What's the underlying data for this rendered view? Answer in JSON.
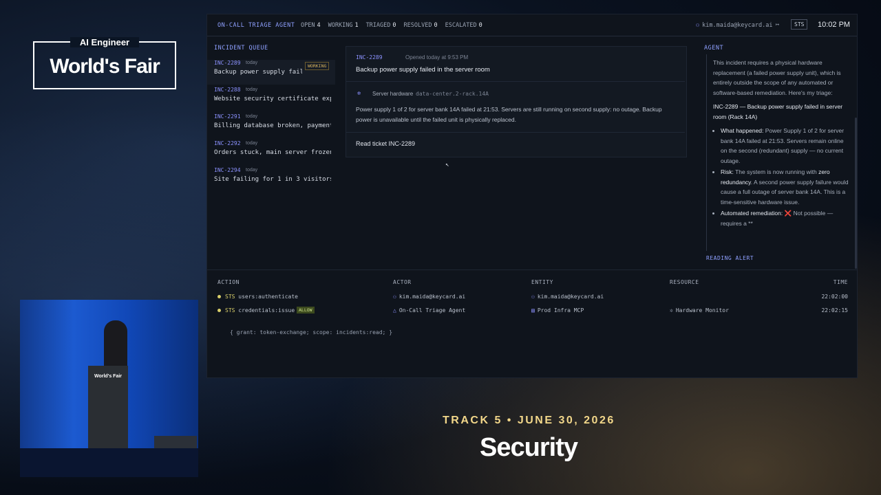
{
  "event": {
    "logo_top": "AI Engineer",
    "logo_main": "World's Fair",
    "podium_label": "World's Fair"
  },
  "stage": {
    "track": "TRACK 5 • JUNE 30, 2026",
    "topic": "Security"
  },
  "topbar": {
    "title": "ON-CALL TRIAGE AGENT",
    "counts": [
      {
        "label": "OPEN",
        "value": "4"
      },
      {
        "label": "WORKING",
        "value": "1"
      },
      {
        "label": "TRIAGED",
        "value": "0"
      },
      {
        "label": "RESOLVED",
        "value": "0"
      },
      {
        "label": "ESCALATED",
        "value": "0"
      }
    ],
    "user": "kim.maida@keycard.ai",
    "sts": "STS",
    "clock": "10:02 PM"
  },
  "queue": {
    "title": "INCIDENT QUEUE",
    "working_badge": "WORKING",
    "items": [
      {
        "id": "INC-2289",
        "when": "today",
        "desc": "Backup power supply failed ..."
      },
      {
        "id": "INC-2288",
        "when": "today",
        "desc": "Website security certificate expiring so..."
      },
      {
        "id": "INC-2291",
        "when": "today",
        "desc": "Billing database broken, payments faili..."
      },
      {
        "id": "INC-2292",
        "when": "today",
        "desc": "Orders stuck, main server frozen"
      },
      {
        "id": "INC-2294",
        "when": "today",
        "desc": "Site failing for 1 in 3 visitors"
      }
    ]
  },
  "detail": {
    "id": "INC-2289",
    "opened": "Opened today at 9:53 PM",
    "title": "Backup power supply failed in the server room",
    "hardware_label": "Server hardware",
    "hardware_path": "data-center.2-rack.14A",
    "body": "Power supply 1 of 2 for server bank 14A failed at 21:53. Servers are still running on second supply: no outage. Backup power is unavailable until the failed unit is physically replaced.",
    "action": "Read ticket INC-2289"
  },
  "agent": {
    "title": "AGENT",
    "intro": "This incident requires a physical hardware replacement (a failed power supply unit), which is entirely outside the scope of any automated or software-based remediation. Here's my triage:",
    "heading": "INC-2289 — Backup power supply failed in server room (Rack 14A)",
    "bullets": [
      {
        "label": "What happened:",
        "text": "Power Supply 1 of 2 for server bank 14A failed at 21:53. Servers remain online on the second (redundant) supply — no current outage."
      },
      {
        "label": "Risk:",
        "text_a": "The system is now running with",
        "bold": "zero redundancy",
        "text_b": ". A second power supply failure would cause a full outage of server bank 14A. This is a time-sensitive hardware issue."
      },
      {
        "label": "Automated remediation:",
        "mark": "❌",
        "text": "Not possible — requires a **"
      }
    ],
    "status": "READING ALERT"
  },
  "log": {
    "headers": {
      "action": "ACTION",
      "actor": "ACTOR",
      "entity": "ENTITY",
      "resource": "RESOURCE",
      "time": "TIME"
    },
    "rows": [
      {
        "prefix": "STS",
        "action": "users:authenticate",
        "actor": "kim.maida@keycard.ai",
        "entity": "kim.maida@keycard.ai",
        "resource": "",
        "time": "22:02:00"
      },
      {
        "prefix": "STS",
        "action": "credentials:issue",
        "badge": "ALLOW",
        "actor": "On-Call Triage Agent",
        "entity": "Prod Infra MCP",
        "resource": "Hardware Monitor",
        "time": "22:02:15"
      }
    ],
    "detail": "{ grant: token-exchange; scope: incidents:read; }"
  }
}
